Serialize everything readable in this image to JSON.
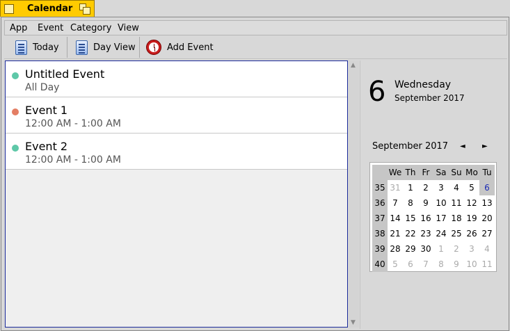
{
  "app": {
    "tab_title": "Calendar"
  },
  "menu": [
    "App",
    "Event",
    "Category",
    "View"
  ],
  "toolbar": {
    "today_label": "Today",
    "dayview_label": "Day View",
    "addevent_label": "Add Event"
  },
  "events": [
    {
      "name": "Untitled Event",
      "time": "All Day",
      "color": "#5ec8a8"
    },
    {
      "name": "Event 1",
      "time": "12:00 AM - 1:00 AM",
      "color": "#e47e64"
    },
    {
      "name": "Event 2",
      "time": "12:00 AM - 1:00 AM",
      "color": "#5ec8a8"
    }
  ],
  "day": {
    "number": "6",
    "weekday": "Wednesday",
    "month_year": "September 2017"
  },
  "calendar": {
    "month_label": "September 2017",
    "prev": "◄",
    "next": "►",
    "headers": [
      "We",
      "Th",
      "Fr",
      "Sa",
      "Su",
      "Mo",
      "Tu"
    ],
    "weeks": [
      {
        "week": "35",
        "days": [
          "31",
          "1",
          "2",
          "3",
          "4",
          "5",
          "6"
        ]
      },
      {
        "week": "36",
        "days": [
          "7",
          "8",
          "9",
          "10",
          "11",
          "12",
          "13"
        ]
      },
      {
        "week": "37",
        "days": [
          "14",
          "15",
          "16",
          "17",
          "18",
          "19",
          "20"
        ]
      },
      {
        "week": "38",
        "days": [
          "21",
          "22",
          "23",
          "24",
          "25",
          "26",
          "27"
        ]
      },
      {
        "week": "39",
        "days": [
          "28",
          "29",
          "30",
          "1",
          "2",
          "3",
          "4"
        ]
      },
      {
        "week": "40",
        "days": [
          "5",
          "6",
          "7",
          "8",
          "9",
          "10",
          "11"
        ]
      }
    ],
    "today_color": "#1a2ab4"
  }
}
